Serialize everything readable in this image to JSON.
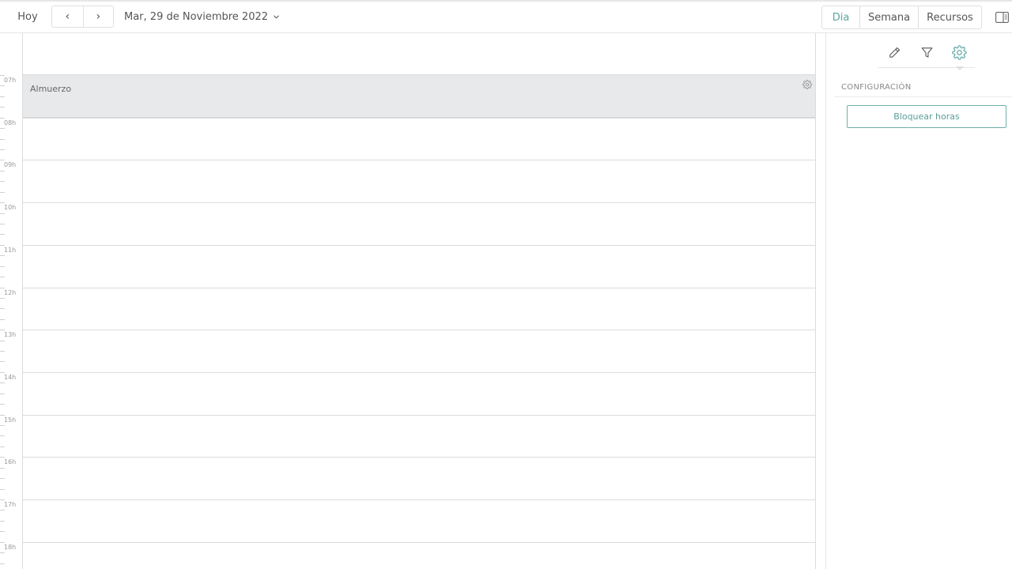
{
  "toolbar": {
    "today_label": "Hoy",
    "prev_label": "‹",
    "next_label": "›",
    "date_label": "Mar, 29 de Noviembre 2022",
    "views": [
      {
        "label": "Dia",
        "active": true
      },
      {
        "label": "Semana",
        "active": false
      },
      {
        "label": "Recursos",
        "active": false
      }
    ],
    "panel_toggle_icon": "sidebar-panel-icon"
  },
  "calendar": {
    "hours": [
      "07h",
      "08h",
      "09h",
      "10h",
      "11h",
      "12h",
      "13h",
      "14h",
      "15h",
      "16h",
      "17h",
      "18h"
    ],
    "events": [
      {
        "title": "Almuerzo",
        "icon": "gear-icon"
      }
    ]
  },
  "panel": {
    "tools": [
      "edit-pencil-icon",
      "filter-icon",
      "gear-icon"
    ],
    "active_tool": "gear-icon",
    "section_title": "CONFIGURACIÓN",
    "block_hours_button": "Bloquear horas"
  },
  "colors": {
    "accent": "#5aa7a0",
    "block_bg": "#e8e9eb",
    "border": "#dcdcdc"
  }
}
